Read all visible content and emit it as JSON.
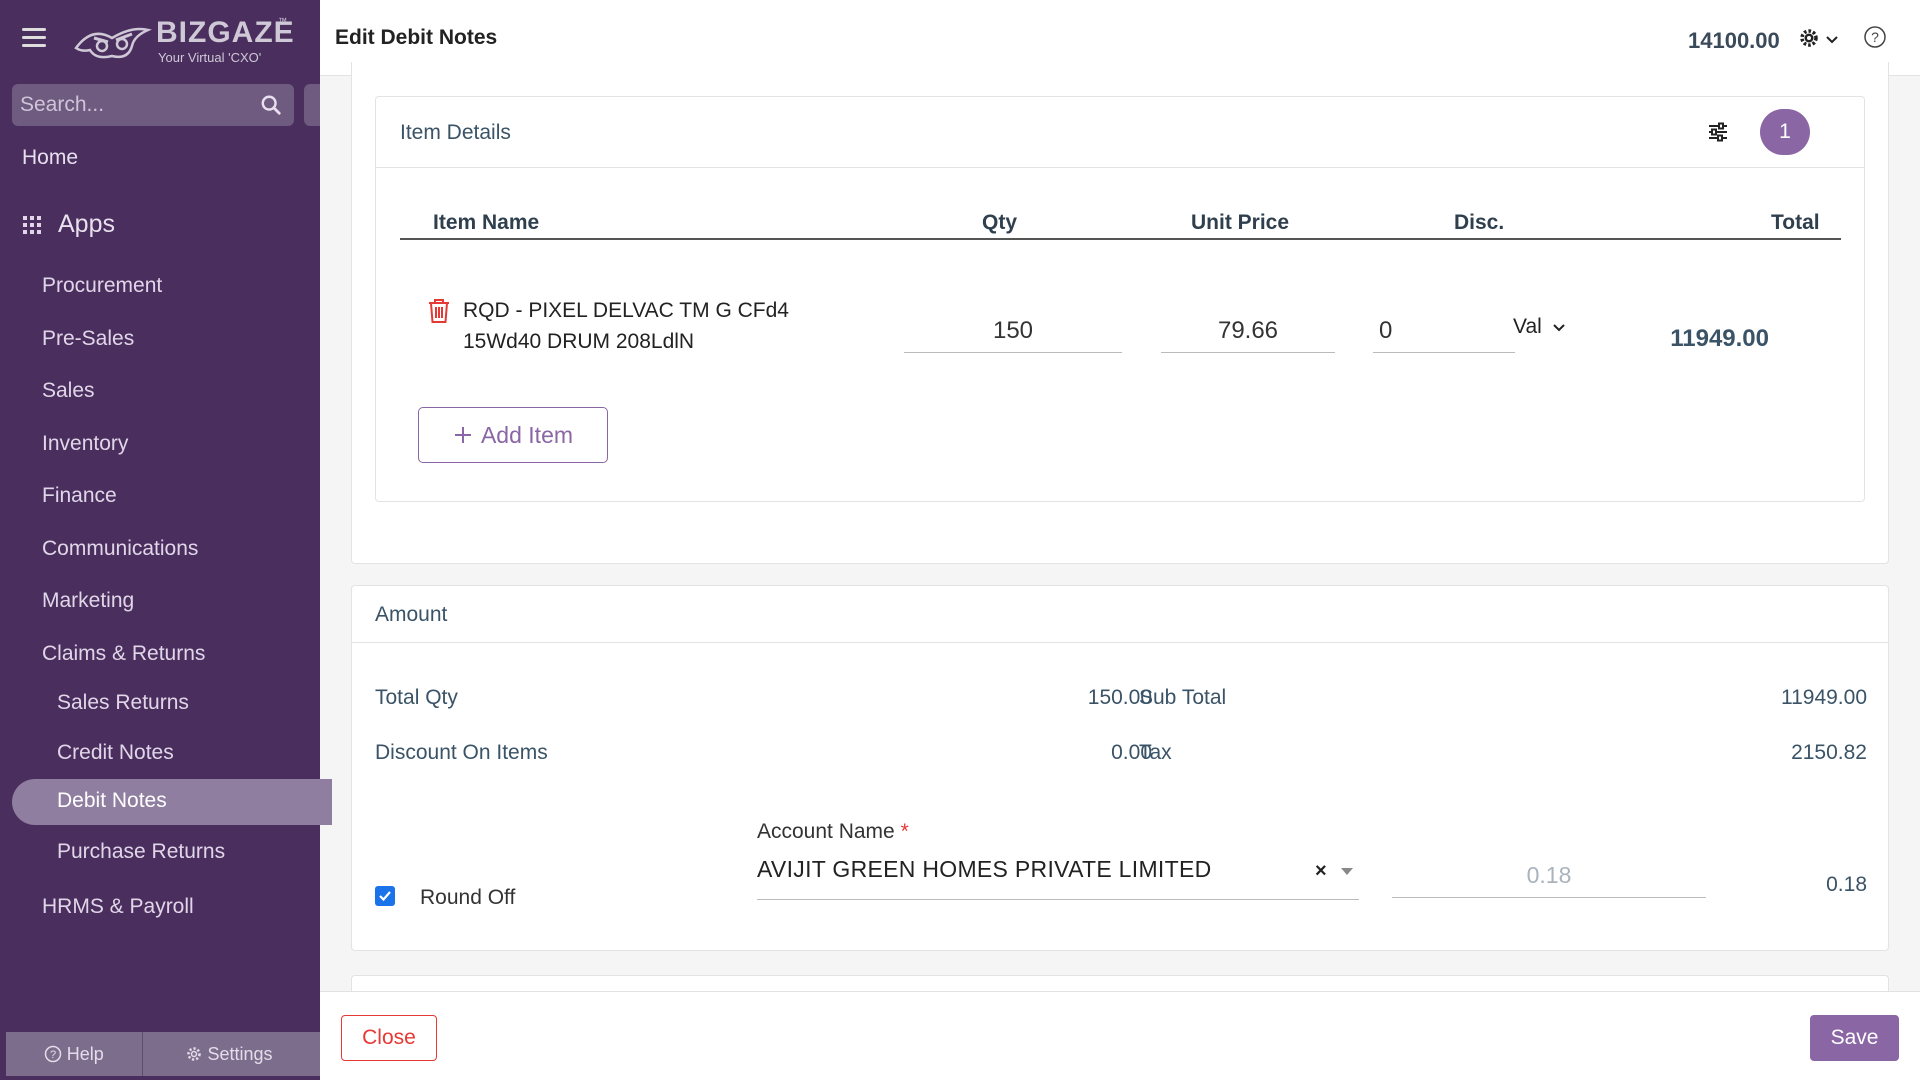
{
  "sidebar": {
    "logo": {
      "name": "BIZGAZE",
      "tagline": "Your Virtual 'CXO'",
      "tm": "™"
    },
    "search_placeholder": "Search...",
    "home": "Home",
    "apps": "Apps",
    "items": [
      {
        "label": "Procurement"
      },
      {
        "label": "Pre-Sales"
      },
      {
        "label": "Sales"
      },
      {
        "label": "Inventory"
      },
      {
        "label": "Finance"
      },
      {
        "label": "Communications"
      },
      {
        "label": "Marketing"
      },
      {
        "label": "Claims & Returns"
      }
    ],
    "sub_items": [
      {
        "label": "Sales Returns"
      },
      {
        "label": "Credit Notes"
      },
      {
        "label": "Debit Notes",
        "active": true
      },
      {
        "label": "Purchase Returns"
      }
    ],
    "hrms": "HRMS & Payroll",
    "help": "Help",
    "settings": "Settings"
  },
  "header": {
    "title": "Edit Debit Notes",
    "total": "14100.00"
  },
  "item_details": {
    "title": "Item Details",
    "count": "1",
    "columns": {
      "name": "Item Name",
      "qty": "Qty",
      "unit_price": "Unit Price",
      "disc": "Disc.",
      "total": "Total"
    },
    "rows": [
      {
        "name": "RQD - PIXEL DELVAC TM G CFd4 15Wd40 DRUM 208LdlN",
        "qty": "150",
        "unit_price": "79.66",
        "disc": "0",
        "disc_type": "Val",
        "total": "11949.00"
      }
    ],
    "add_item": "Add Item"
  },
  "amount": {
    "title": "Amount",
    "total_qty_label": "Total Qty",
    "total_qty": "150.00",
    "discount_label": "Discount On Items",
    "discount": "0.00",
    "subtotal_label": "Sub Total",
    "subtotal": "11949.00",
    "tax_label": "Tax",
    "tax": "2150.82",
    "round_off_label": "Round Off",
    "round_off_checked": true,
    "account_label": "Account Name",
    "account_value": "AVIJIT GREEN HOMES PRIVATE LIMITED",
    "round_off_placeholder": "0.18",
    "round_off_value": "0.18"
  },
  "footer": {
    "close": "Close",
    "save": "Save"
  },
  "colors": {
    "sidebar_bg": "#4a2e5e",
    "accent": "#8a66a5",
    "danger": "#e53935"
  }
}
